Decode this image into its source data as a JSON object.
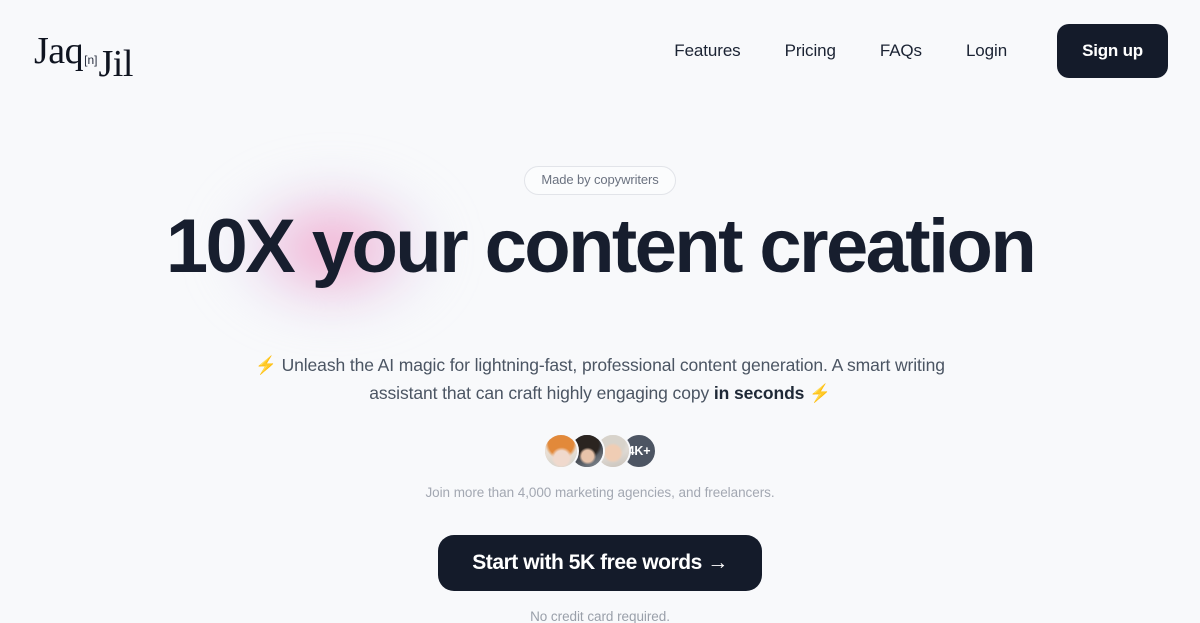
{
  "header": {
    "logo": {
      "part_a": "Jaq",
      "part_n": "[n]",
      "part_b": "Jil"
    },
    "nav_items": [
      {
        "label": "Features"
      },
      {
        "label": "Pricing"
      },
      {
        "label": "FAQs"
      },
      {
        "label": "Login"
      }
    ],
    "signup_label": "Sign up"
  },
  "hero": {
    "badge": "Made by copywriters",
    "headline": "10X your content creation",
    "subhead_bolt_left": "⚡",
    "subhead_text_1": "Unleash the AI magic for lightning-fast, professional content generation. A smart writing assistant that can craft highly engaging copy ",
    "subhead_bold": "in seconds",
    "subhead_bolt_right": "⚡",
    "avatar_count": "4K+",
    "join_line": "Join more than 4,000 marketing agencies, and freelancers.",
    "cta_label": "Start with 5K free words →",
    "cta_note": "No credit card required."
  },
  "colors": {
    "page_background": "#f8f9fb",
    "ink": "#171e2e",
    "button_dark": "#141b2a",
    "muted": "#9aa0aa",
    "glow_pink": "#f394c4",
    "glow_lavender": "#c8cdf0",
    "bolt_yellow": "#f2b93a",
    "avatar_count_bg": "#4d5563"
  }
}
